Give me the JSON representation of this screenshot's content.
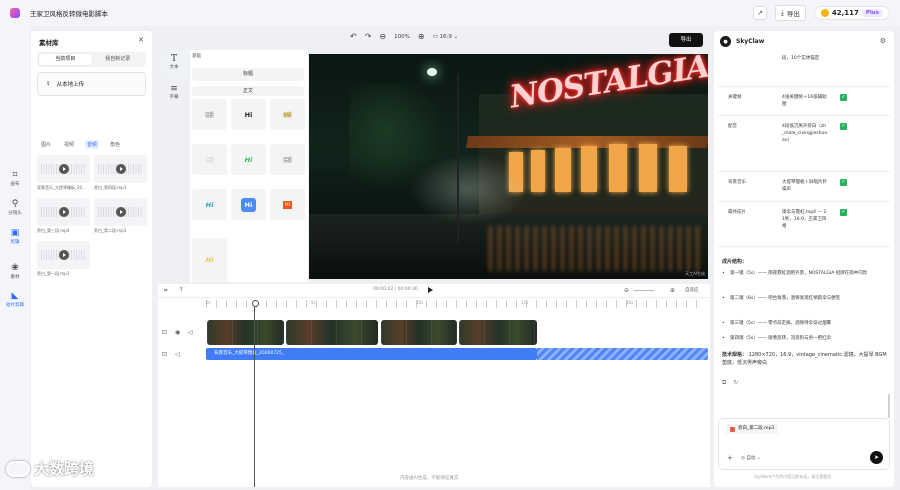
{
  "topbar": {
    "project_title": "王家卫风格反转微电影脚本",
    "export_label": "导出",
    "credits": "42,117",
    "plus_label": "Plus"
  },
  "left_rail": [
    {
      "icon": "crop-icon",
      "label": "画布"
    },
    {
      "icon": "storyboard-icon",
      "label": "分镜头"
    },
    {
      "icon": "video-icon",
      "label": "剪辑"
    },
    {
      "icon": "assets-icon",
      "label": "素材"
    },
    {
      "icon": "logo-icon",
      "label": "短片剪辑"
    }
  ],
  "asset_panel": {
    "title": "素材库",
    "tabs": [
      "当前项目",
      "我自制记录"
    ],
    "upload_label": "从本地上传",
    "categories": [
      "图片",
      "视频",
      "音频",
      "角色"
    ],
    "active_category": "音频",
    "audio_items": [
      "背景音乐_大提琴慢板_20...",
      "旁白_第四段.mp3",
      "旁白_第三段.mp4",
      "旁白_第二段.mp3",
      "旁白_第一段.mp3"
    ]
  },
  "toolbar": {
    "zoom": "100%",
    "ratio": "16:9",
    "export_button": "导出"
  },
  "tools": [
    {
      "icon": "T",
      "label": "文本"
    },
    {
      "icon": "≡",
      "label": "字幕"
    }
  ],
  "text_panel": {
    "heading": "基础",
    "title_btn": "标题",
    "body_btn": "正文",
    "presets": [
      "Hi",
      "Hi",
      "Hi",
      "Hi",
      "Hi",
      "Hi",
      "Hi",
      "Hi",
      "Hi",
      "Hi"
    ]
  },
  "preview": {
    "neon_text": "NOSTALGIA",
    "watermark": "天工AI生成"
  },
  "timeline": {
    "time": "00:00:02 / 00:00:30",
    "fit_label": "自适应",
    "ruler": [
      "0s",
      "5s",
      "10s",
      "15s",
      "20s"
    ],
    "audio_clip": "背景音乐_大提琴慢板_20260725_",
    "disclaimer": "内容由AI生成，不能保证真实"
  },
  "chat": {
    "title": "SkyClaw",
    "rows": [
      {
        "k": "",
        "v": "段，10个实体锚定"
      },
      {
        "k": "关键帧",
        "v": "4张关键帧＋16张辅助图"
      },
      {
        "k": "配音",
        "v": "4段低沉男声旁白（zh_male_cixingjieshuoan）"
      },
      {
        "k": "背景音乐",
        "v": "大提琴慢板＋旧唱片针噪声"
      },
      {
        "k": "最终成片",
        "v": "雨伞与霓虹.mp4 — 21秒，16:9，王家卫风格"
      }
    ],
    "structure_title": "成片结构：",
    "bullets": [
      "第一镜（5s）—— 雨夜霓虹酒吧外景，NOSTALGIA 招牌在雨中闪烁",
      "第二镜（6s）—— 吧台角落，酒保发现红柄雨伞与便签",
      "第三镜（5s）—— 零点前走廊，酒保持伞穿过烟雾",
      "第四镜（5s）—— 街巷反转，流浪狗与另一把红伞"
    ],
    "spec_title": "技术规格：",
    "spec_text": "1280×720，16:9，vintage_cinematic 滤镜，大提琴 BGM 垫底，低沉男声旁白",
    "attachment": "旁白_第二段.mp3",
    "mode_label": "自动",
    "footer": "SkyWork产生的内容可能有误，请注意甄别"
  },
  "watermark_logo": "大数跨境",
  "colors": {
    "accent": "#2e6bff",
    "audio_track": "#3f7cf6",
    "ok": "#27b35a"
  }
}
